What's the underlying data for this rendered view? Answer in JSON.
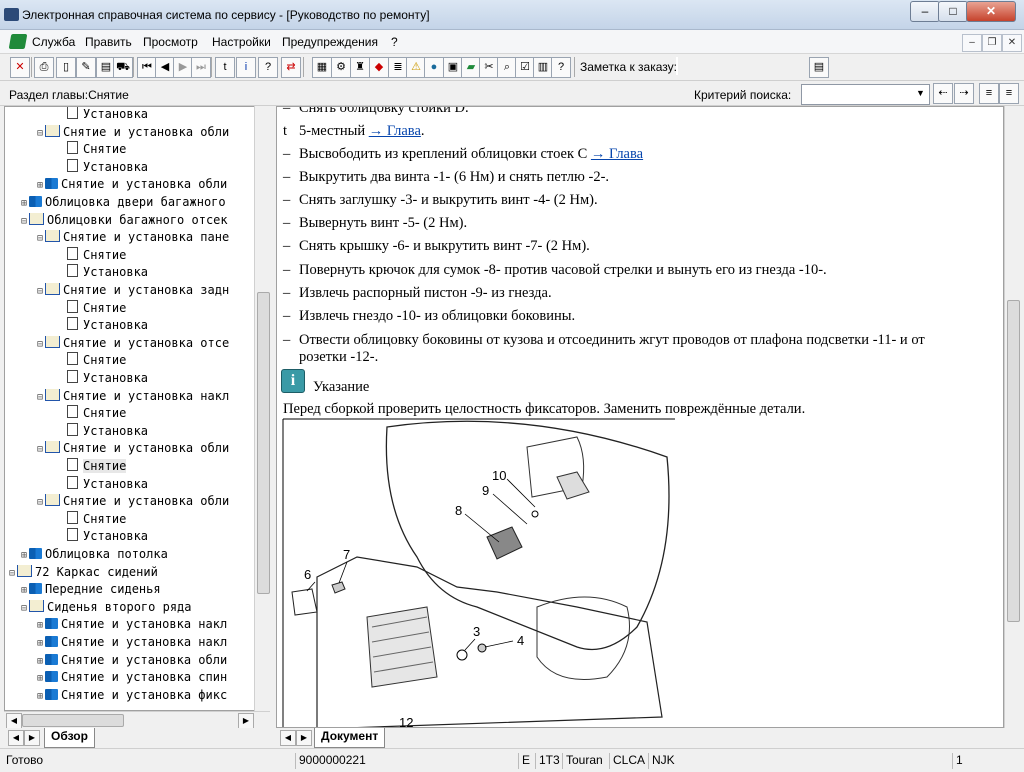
{
  "window": {
    "title": "Электронная справочная система по сервису - [Руководство по ремонту]",
    "buttons": [
      "–",
      "□",
      "✕"
    ]
  },
  "menu": {
    "items": [
      "Служба",
      "Править",
      "Просмотр",
      "Настройки",
      "Предупреждения",
      "?"
    ]
  },
  "toolbar": {
    "order_note_label": "Заметка к заказу:"
  },
  "section": {
    "label": "Раздел главы:Снятие",
    "criteria_label": "Критерий поиска:"
  },
  "tree": {
    "rows": [
      {
        "text": "Установка",
        "icon": "doc-icon",
        "level": 4
      },
      {
        "text": "Снятие и установка обли",
        "icon": "open-book-icon",
        "level": 3
      },
      {
        "text": "Снятие",
        "icon": "doc-icon",
        "level": 4
      },
      {
        "text": "Установка",
        "icon": "doc-icon",
        "level": 4
      },
      {
        "text": "Снятие и установка обли",
        "icon": "book-icon",
        "level": 3
      },
      {
        "text": "Облицовка двери багажного",
        "icon": "book-icon",
        "level": 2
      },
      {
        "text": "Облицовки багажного отсек",
        "icon": "open-book-icon",
        "level": 2
      },
      {
        "text": "Снятие и установка пане",
        "icon": "open-book-icon",
        "level": 3
      },
      {
        "text": "Снятие",
        "icon": "doc-icon",
        "level": 4
      },
      {
        "text": "Установка",
        "icon": "doc-icon",
        "level": 4
      },
      {
        "text": "Снятие и установка задн",
        "icon": "open-book-icon",
        "level": 3
      },
      {
        "text": "Снятие",
        "icon": "doc-icon",
        "level": 4
      },
      {
        "text": "Установка",
        "icon": "doc-icon",
        "level": 4
      },
      {
        "text": "Снятие и установка отсе",
        "icon": "open-book-icon",
        "level": 3
      },
      {
        "text": "Снятие",
        "icon": "doc-icon",
        "level": 4
      },
      {
        "text": "Установка",
        "icon": "doc-icon",
        "level": 4
      },
      {
        "text": "Снятие и установка накл",
        "icon": "open-book-icon",
        "level": 3
      },
      {
        "text": "Снятие",
        "icon": "doc-icon",
        "level": 4
      },
      {
        "text": "Установка",
        "icon": "doc-icon",
        "level": 4
      },
      {
        "text": "Снятие и установка обли",
        "icon": "open-book-icon",
        "level": 3
      },
      {
        "text": "Снятие",
        "icon": "doc-icon",
        "level": 4,
        "selected": true
      },
      {
        "text": "Установка",
        "icon": "doc-icon",
        "level": 4
      },
      {
        "text": "Снятие и установка обли",
        "icon": "open-book-icon",
        "level": 3
      },
      {
        "text": "Снятие",
        "icon": "doc-icon",
        "level": 4
      },
      {
        "text": "Установка",
        "icon": "doc-icon",
        "level": 4
      },
      {
        "text": "Облицовка потолка",
        "icon": "book-icon",
        "level": 2
      },
      {
        "text": "72 Каркас сидений",
        "icon": "open-book-icon",
        "level": 1
      },
      {
        "text": "Передние сиденья",
        "icon": "book-icon",
        "level": 2
      },
      {
        "text": "Сиденья второго ряда",
        "icon": "open-book-icon",
        "level": 2
      },
      {
        "text": "Снятие и установка накл",
        "icon": "book-icon",
        "level": 3
      },
      {
        "text": "Снятие и установка накл",
        "icon": "book-icon",
        "level": 3
      },
      {
        "text": "Снятие и установка обли",
        "icon": "book-icon",
        "level": 3
      },
      {
        "text": "Снятие и установка спин",
        "icon": "book-icon",
        "level": 3
      },
      {
        "text": "Снятие и установка фикс",
        "icon": "book-icon",
        "level": 3
      }
    ],
    "tab_label": "Обзор"
  },
  "document": {
    "tab_label": "Документ",
    "lines": [
      {
        "dash": "–",
        "text": "Снять облицовку стойки D."
      },
      {
        "dash": "t",
        "text": "5-местный ",
        "link": "→ Глава",
        "after": "."
      },
      {
        "dash": "–",
        "text": "Высвободить из креплений облицовки стоек C ",
        "link": "→ Глава",
        "after": ""
      },
      {
        "dash": "–",
        "text": "Выкрутить два винта -1- (6 Нм) и снять петлю -2-."
      },
      {
        "dash": "–",
        "text": "Снять заглушку -3- и выкрутить винт -4- (2 Нм)."
      },
      {
        "dash": "–",
        "text": "Вывернуть винт -5- (2 Нм)."
      },
      {
        "dash": "–",
        "text": "Снять крышку -6- и выкрутить винт -7- (2 Нм)."
      },
      {
        "dash": "–",
        "text": "Повернуть крючок для сумок -8- против часовой стрелки и вынуть его из гнезда -10-."
      },
      {
        "dash": "–",
        "text": "Извлечь распорный пистон -9- из гнезда."
      },
      {
        "dash": "–",
        "text": "Извлечь гнездо -10- из облицовки боковины."
      },
      {
        "dash": "–",
        "text": "Отвести облицовку боковины от кузова и отсоединить жгут проводов от плафона подсветки -11- и от"
      },
      {
        "dash": "",
        "text": "розетки -12-."
      }
    ],
    "note_title": "Указание",
    "note_text": "Перед сборкой проверить целостность фиксаторов. Заменить повреждённые детали.",
    "figure_labels": [
      "10",
      "9",
      "8",
      "7",
      "6",
      "3",
      "4",
      "12"
    ]
  },
  "status": {
    "ready": "Готово",
    "code": "9000000221",
    "e": "E",
    "t": "1T3",
    "model": "Touran",
    "engine": "CLCA",
    "gear": "NJK",
    "page": "1"
  }
}
